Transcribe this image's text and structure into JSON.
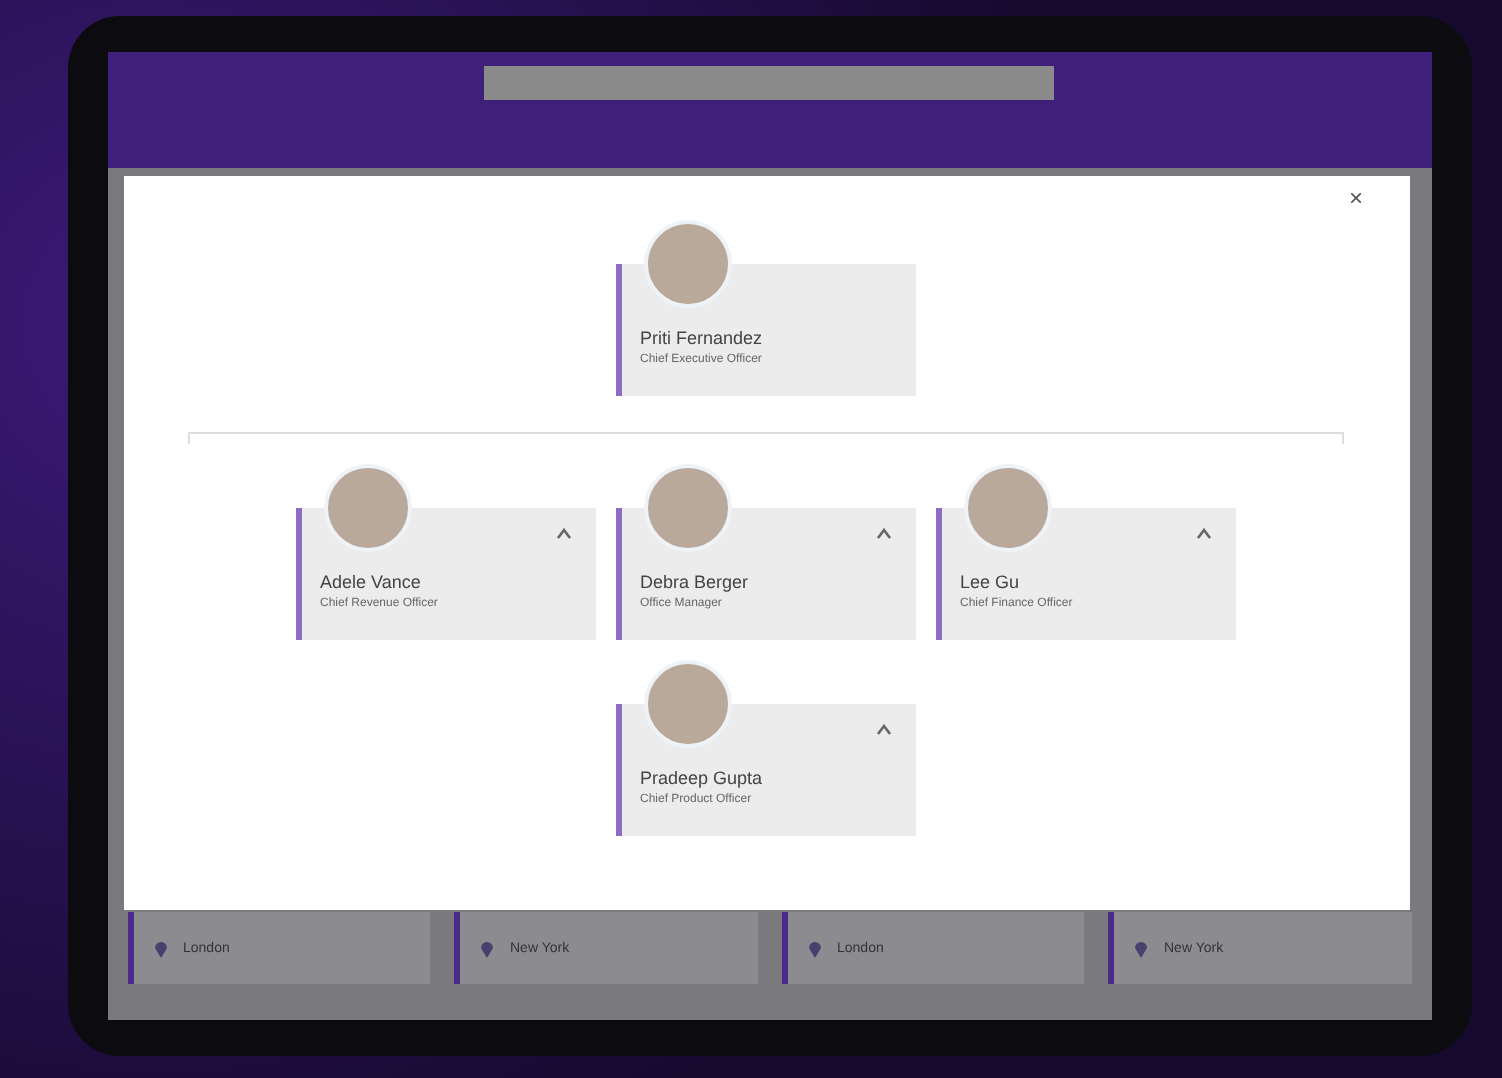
{
  "modal": {
    "close": "×",
    "root": {
      "name": "Priti Fernandez",
      "title": "Chief Executive Officer",
      "collapsible": false
    },
    "reports": [
      {
        "name": "Adele Vance",
        "title": "Chief Revenue Officer",
        "collapsible": true
      },
      {
        "name": "Debra Berger",
        "title": "Office Manager",
        "collapsible": true
      },
      {
        "name": "Lee Gu",
        "title": "Chief Finance Officer",
        "collapsible": true
      },
      {
        "name": "Pradeep Gupta",
        "title": "Chief Product Officer",
        "collapsible": true
      }
    ]
  },
  "background_cards": [
    {
      "location": "London"
    },
    {
      "location": "New York"
    },
    {
      "location": "London"
    },
    {
      "location": "New York"
    }
  ]
}
